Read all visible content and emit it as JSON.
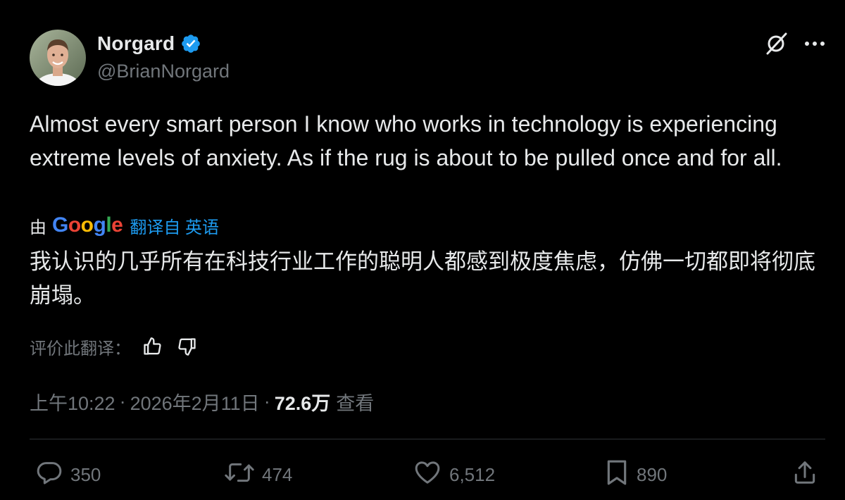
{
  "author": {
    "display_name": "Norgard",
    "handle": "@BrianNorgard",
    "verified_icon": "verified-badge-icon"
  },
  "header_icons": [
    "grok-icon",
    "more-icon"
  ],
  "tweet": {
    "text": "Almost every smart person I know who works in technology is experiencing extreme levels of anxiety. As if the rug is about to be pulled once and for all."
  },
  "translation": {
    "by_label": "由",
    "provider": "Google",
    "link_label": "翻译自 英语",
    "text": "我认识的几乎所有在科技行业工作的聪明人都感到极度焦虑，仿佛一切都即将彻底崩塌。",
    "rate_label": "评价此翻译："
  },
  "meta": {
    "time": "上午10:22",
    "separator": "·",
    "date": "2026年2月11日",
    "views_count": "72.6万",
    "views_label": "查看"
  },
  "actions": {
    "replies": "350",
    "reposts": "474",
    "likes": "6,512",
    "bookmarks": "890"
  },
  "colors": {
    "background": "#000000",
    "text": "#e7e9ea",
    "secondary": "#71767b",
    "accent": "#1d9bf0",
    "divider": "#2f3336"
  }
}
